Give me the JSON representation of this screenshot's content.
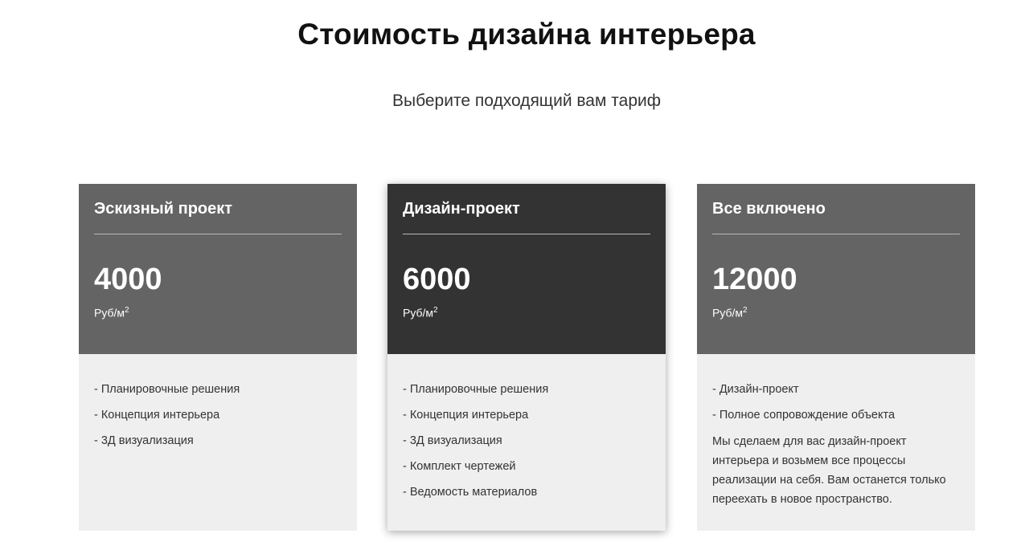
{
  "header": {
    "title": "Стоимость дизайна интерьера",
    "subtitle": "Выберите подходящий вам тариф"
  },
  "plans": [
    {
      "name": "Эскизный проект",
      "price": "4000",
      "unit": "Руб/м",
      "unit_sup": "2",
      "features": [
        "- Планировочные решения",
        "- Концепция интерьера",
        "- 3Д визуализация"
      ]
    },
    {
      "name": "Дизайн-проект",
      "price": "6000",
      "unit": "Руб/м",
      "unit_sup": "2",
      "features": [
        "- Планировочные решения",
        "- Концепция интерьера",
        "- 3Д визуализация",
        "- Комплект чертежей",
        "- Ведомость материалов"
      ]
    },
    {
      "name": "Все включено",
      "price": "12000",
      "unit": "Руб/м",
      "unit_sup": "2",
      "features": [
        "- Дизайн-проект",
        "- Полное сопровождение объекта"
      ],
      "note": "Мы сделаем для вас дизайн-проект интерьера и возьмем все процессы реализации на себя. Вам останется только переехать в новое пространство."
    }
  ],
  "colors": {
    "card_head": "#646464",
    "card_head_featured": "#333333",
    "card_body": "#efefef"
  }
}
